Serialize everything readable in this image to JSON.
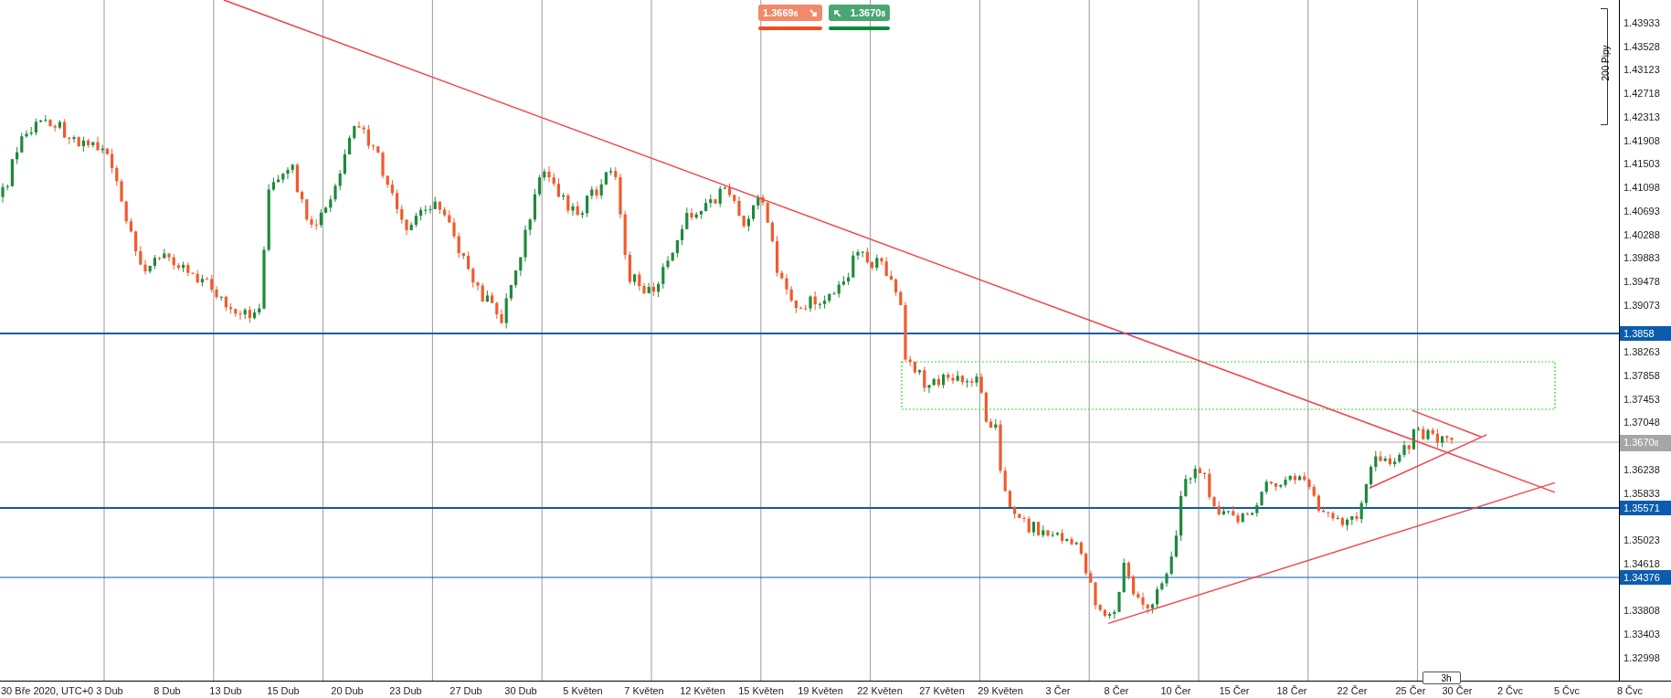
{
  "trade_buttons": [
    {
      "kind": "sell",
      "price": "1.3669$_{6}$"
    },
    {
      "kind": "buy",
      "price": "1.3670$_{8}$"
    }
  ],
  "ruler": {
    "label": "200 Pipy"
  },
  "price_axis": {
    "ticks": [
      "1.43933",
      "1.43528",
      "1.43123",
      "1.42718",
      "1.42313",
      "1.41908",
      "1.41503",
      "1.41098",
      "1.40693",
      "1.40288",
      "1.39883",
      "1.39478",
      "1.39073",
      "1.38263",
      "1.37858",
      "1.37453",
      "1.37048",
      "1.36238",
      "1.35833",
      "1.35023",
      "1.34618",
      "1.33808",
      "1.33403",
      "1.32998"
    ]
  },
  "price_levels": [
    {
      "label": "1.3858",
      "color": "#0b5cad"
    },
    {
      "label": "1.3670$_{8}$",
      "color": "#a6a6a6"
    },
    {
      "label": "1.35571",
      "color": "#0b5cad"
    },
    {
      "label": "1.34376",
      "color": "#0b5cad"
    }
  ],
  "time_axis": {
    "labels": [
      "30 Bře 2020, UTC+0",
      "3 Dub",
      "8 Dub",
      "13 Dub",
      "15 Dub",
      "20 Dub",
      "23 Dub",
      "27 Dub",
      "30 Dub",
      "5 Květen",
      "7 Květen",
      "12 Květen",
      "15 Květen",
      "19 Květen",
      "22 Květen",
      "27 Květen",
      "29 Květen",
      "3 Čer",
      "8 Čer",
      "10 Čer",
      "15 Čer",
      "18 Čer",
      "22 Čer",
      "25 Čer",
      "30 Čer",
      "2 Čvc",
      "5 Čvc",
      "8 Čvc"
    ]
  },
  "timeframe": "3h"
}
